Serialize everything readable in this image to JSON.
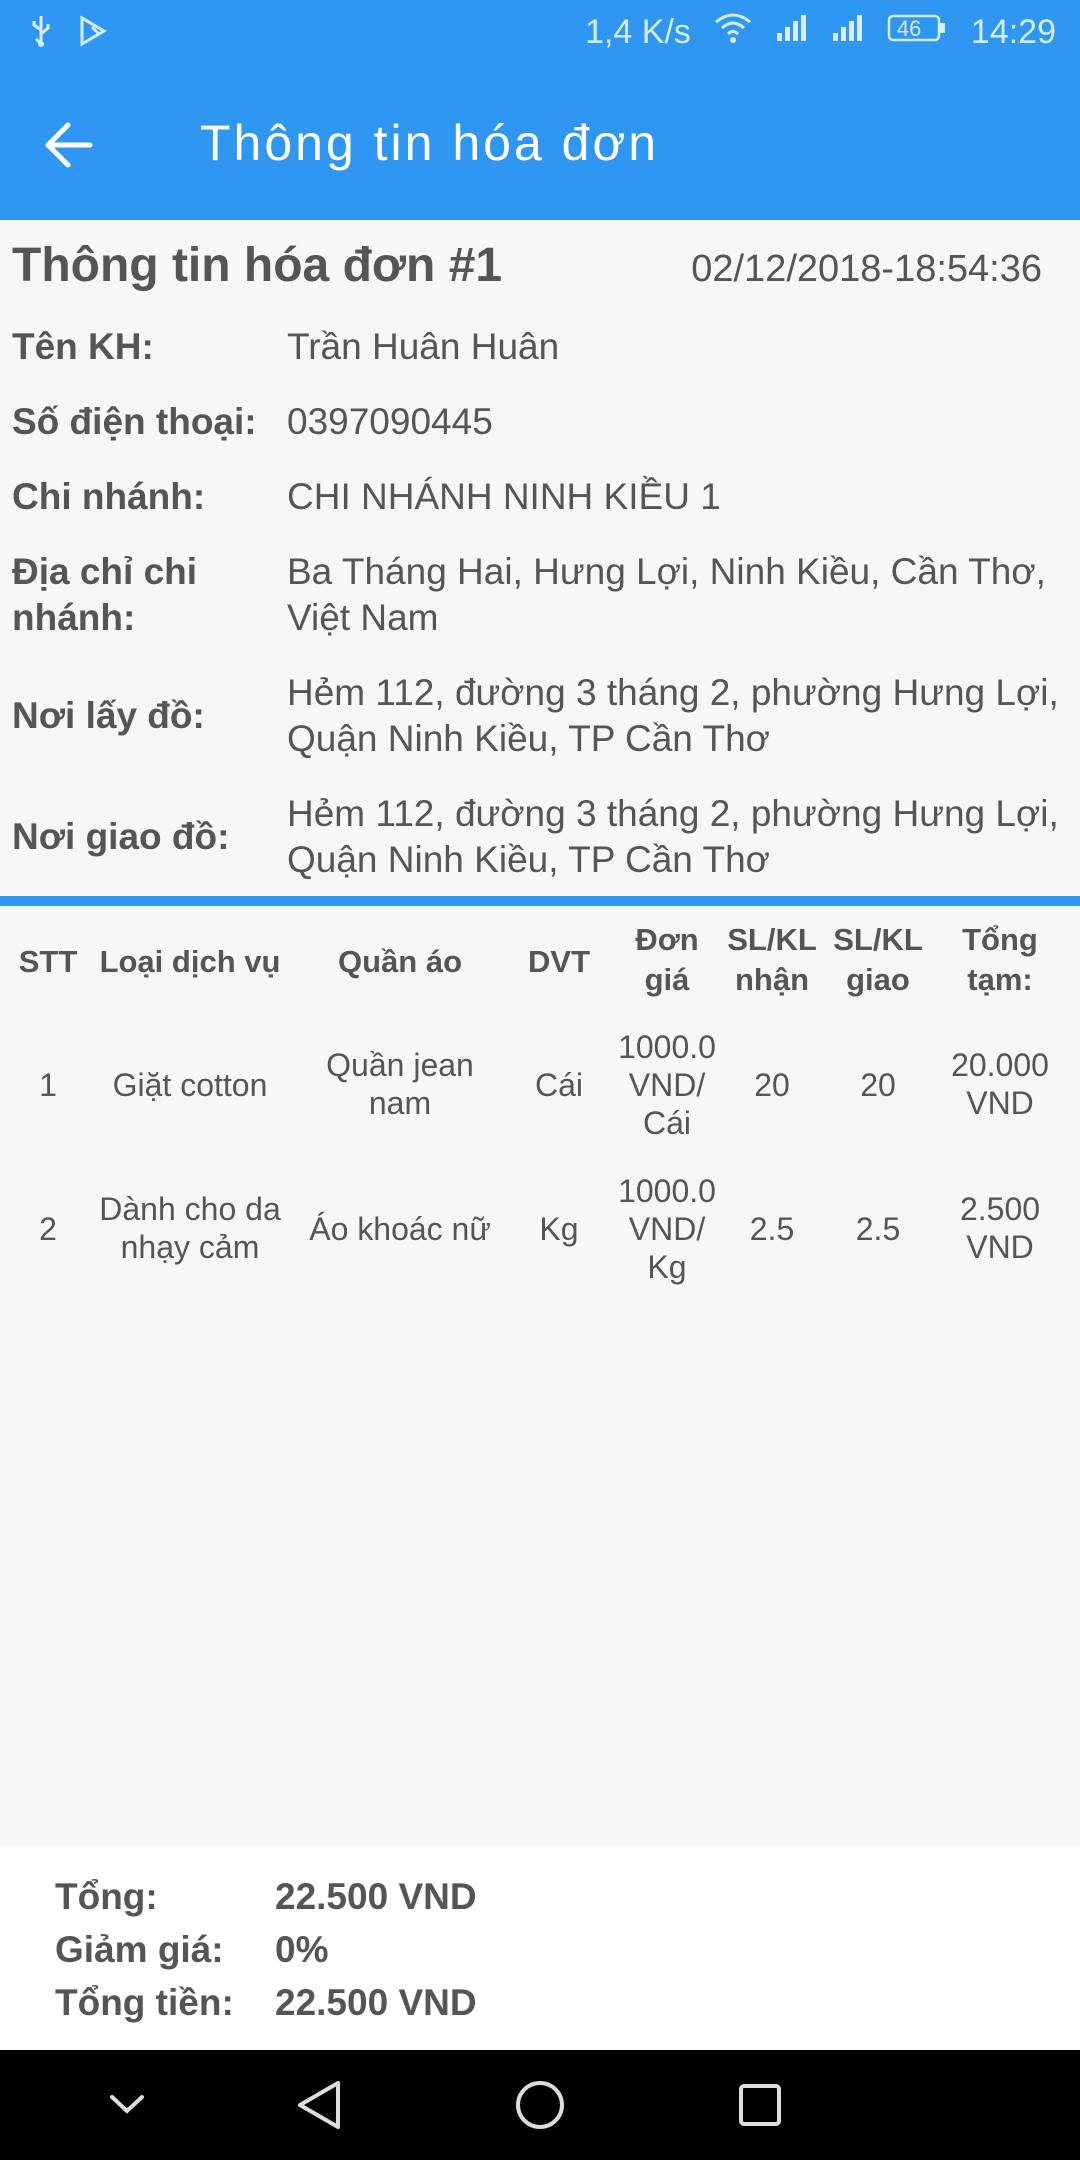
{
  "status_bar": {
    "speed": "1,4 K/s",
    "battery": "46",
    "time": "14:29"
  },
  "app_bar": {
    "title": "Thông tin hóa đơn",
    "back_icon": "arrow-left-icon"
  },
  "invoice": {
    "heading": "Thông tin hóa đơn #1",
    "datetime": "02/12/2018-18:54:36",
    "fields": [
      {
        "label": "Tên KH:",
        "value": "Trần Huân Huân"
      },
      {
        "label": "Số điện thoại:",
        "value": "0397090445"
      },
      {
        "label": "Chi nhánh:",
        "value": "CHI NHÁNH NINH KIỀU 1"
      },
      {
        "label": "Địa chỉ chi nhánh:",
        "value": "Ba Tháng Hai, Hưng Lợi, Ninh Kiều, Cần Thơ, Việt Nam"
      },
      {
        "label": "Nơi lấy đồ:",
        "value": "Hẻm 112, đường 3 tháng 2, phường Hưng Lợi, Quận Ninh Kiều, TP Cần Thơ"
      },
      {
        "label": "Nơi giao đồ:",
        "value": "Hẻm 112, đường 3 tháng 2, phường Hưng Lợi, Quận Ninh Kiều, TP Cần Thơ"
      }
    ]
  },
  "table": {
    "headers": [
      "STT",
      "Loại dịch vụ",
      "Quần áo",
      "DVT",
      "Đơn giá",
      "SL/KL nhận",
      "SL/KL giao",
      "Tổng tạm:"
    ],
    "rows": [
      [
        "1",
        "Giặt cotton",
        "Quần jean nam",
        "Cái",
        "1000.0 VND/ Cái",
        "20",
        "20",
        "20.000 VND"
      ],
      [
        "2",
        "Dành cho da nhạy cảm",
        "Áo khoác nữ",
        "Kg",
        "1000.0 VND/ Kg",
        "2.5",
        "2.5",
        "2.500 VND"
      ]
    ]
  },
  "summary": {
    "total_label": "Tổng:",
    "total_value": "22.500 VND",
    "discount_label": "Giảm giá:",
    "discount_value": "0%",
    "grand_label": "Tổng tiền:",
    "grand_value": "22.500 VND"
  },
  "nav_bar": {
    "icons": [
      "chevron-down-icon",
      "back-triangle-icon",
      "home-circle-icon",
      "recents-square-icon"
    ]
  },
  "colors": {
    "primary": "#2f97f2",
    "text": "#555555",
    "background": "#f7f7f7"
  }
}
